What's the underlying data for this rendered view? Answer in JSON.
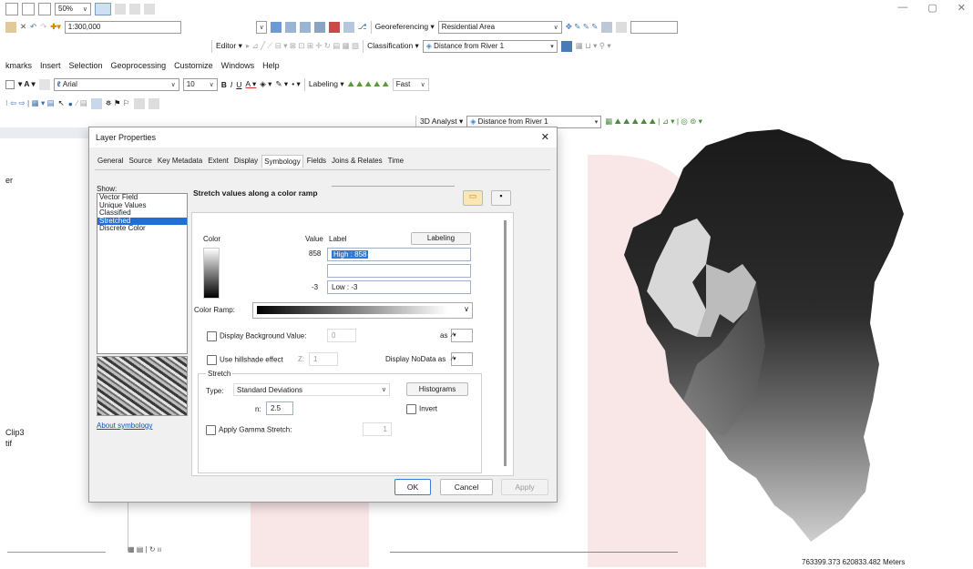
{
  "window": {
    "minimize": "—",
    "restore": "▢",
    "close": "✕"
  },
  "toolbar_row1": {
    "zoom_percent": "50%"
  },
  "toolbar_row2": {
    "scale": "1:300,000",
    "georef_menu": "Georeferencing ▾",
    "georef_layer": "Residential Area"
  },
  "toolbar_row3": {
    "editor_menu": "Editor ▾",
    "classification_menu": "Classification ▾",
    "classification_layer": "Distance from River 1"
  },
  "menubar": {
    "items": [
      "kmarks",
      "Insert",
      "Selection",
      "Geoprocessing",
      "Customize",
      "Windows",
      "Help"
    ]
  },
  "toolbar_row5": {
    "font": "Arial",
    "font_size": "10",
    "labeling_menu": "Labeling ▾",
    "quality": "Fast"
  },
  "toolbar_row6": {
    "analyst_menu": "3D Analyst ▾",
    "analyst_layer": "Distance from River 1"
  },
  "toc": {
    "partial_label": "er",
    "clip_item": "Clip3",
    "tif_item": "tif"
  },
  "status": {
    "coords": "763399.373  620833.482 Meters"
  },
  "dialog": {
    "title": "Layer Properties",
    "close": "✕",
    "tabs": [
      "General",
      "Source",
      "Key Metadata",
      "Extent",
      "Display",
      "Symbology",
      "Fields",
      "Joins & Relates",
      "Time"
    ],
    "active_tab": "Symbology",
    "show_label": "Show:",
    "show_items": [
      "Vector Field",
      "Unique Values",
      "Classified",
      "Stretched",
      "Discrete Color"
    ],
    "selected_show": "Stretched",
    "about_link": "About symbology",
    "heading": "Stretch values along a color ramp",
    "color_label": "Color",
    "value_label": "Value",
    "label_label": "Label",
    "labeling_button": "Labeling",
    "high_value": "858",
    "high_label": "High : 858",
    "low_value": "-3",
    "low_label": "Low : -3",
    "color_ramp_label": "Color Ramp:",
    "display_bg_label": "Display Background Value:",
    "bg_value": "0",
    "as_label": "as",
    "hillshade_label": "Use hillshade effect",
    "z_label": "Z:",
    "z_value": "1",
    "nodata_label": "Display NoData as",
    "stretch_group": "Stretch",
    "type_label": "Type:",
    "type_value": "Standard Deviations",
    "histograms_button": "Histograms",
    "n_label": "n:",
    "n_value": "2.5",
    "invert_label": "Invert",
    "gamma_label": "Apply Gamma Stretch:",
    "gamma_value": "1",
    "ok": "OK",
    "cancel": "Cancel",
    "apply": "Apply"
  }
}
